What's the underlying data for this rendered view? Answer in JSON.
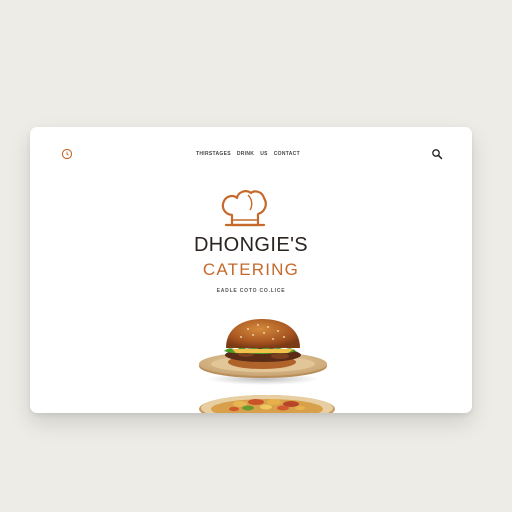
{
  "header": {
    "logo_icon": "circle-logo-icon",
    "nav": [
      "THIRSTAGES",
      "DRINK",
      "US",
      "CONTACT"
    ],
    "search_icon": "search-icon"
  },
  "hero": {
    "hat_icon": "chef-hat-icon",
    "brand_name": "DHONGIE'S",
    "brand_sub": "CATERING",
    "tagline": "EADLE COTO CO.LICE"
  },
  "colors": {
    "accent": "#c56a2b",
    "text_dark": "#2a2420",
    "background": "#eeece6"
  },
  "images": [
    "burger-plate",
    "pasta-plate"
  ]
}
